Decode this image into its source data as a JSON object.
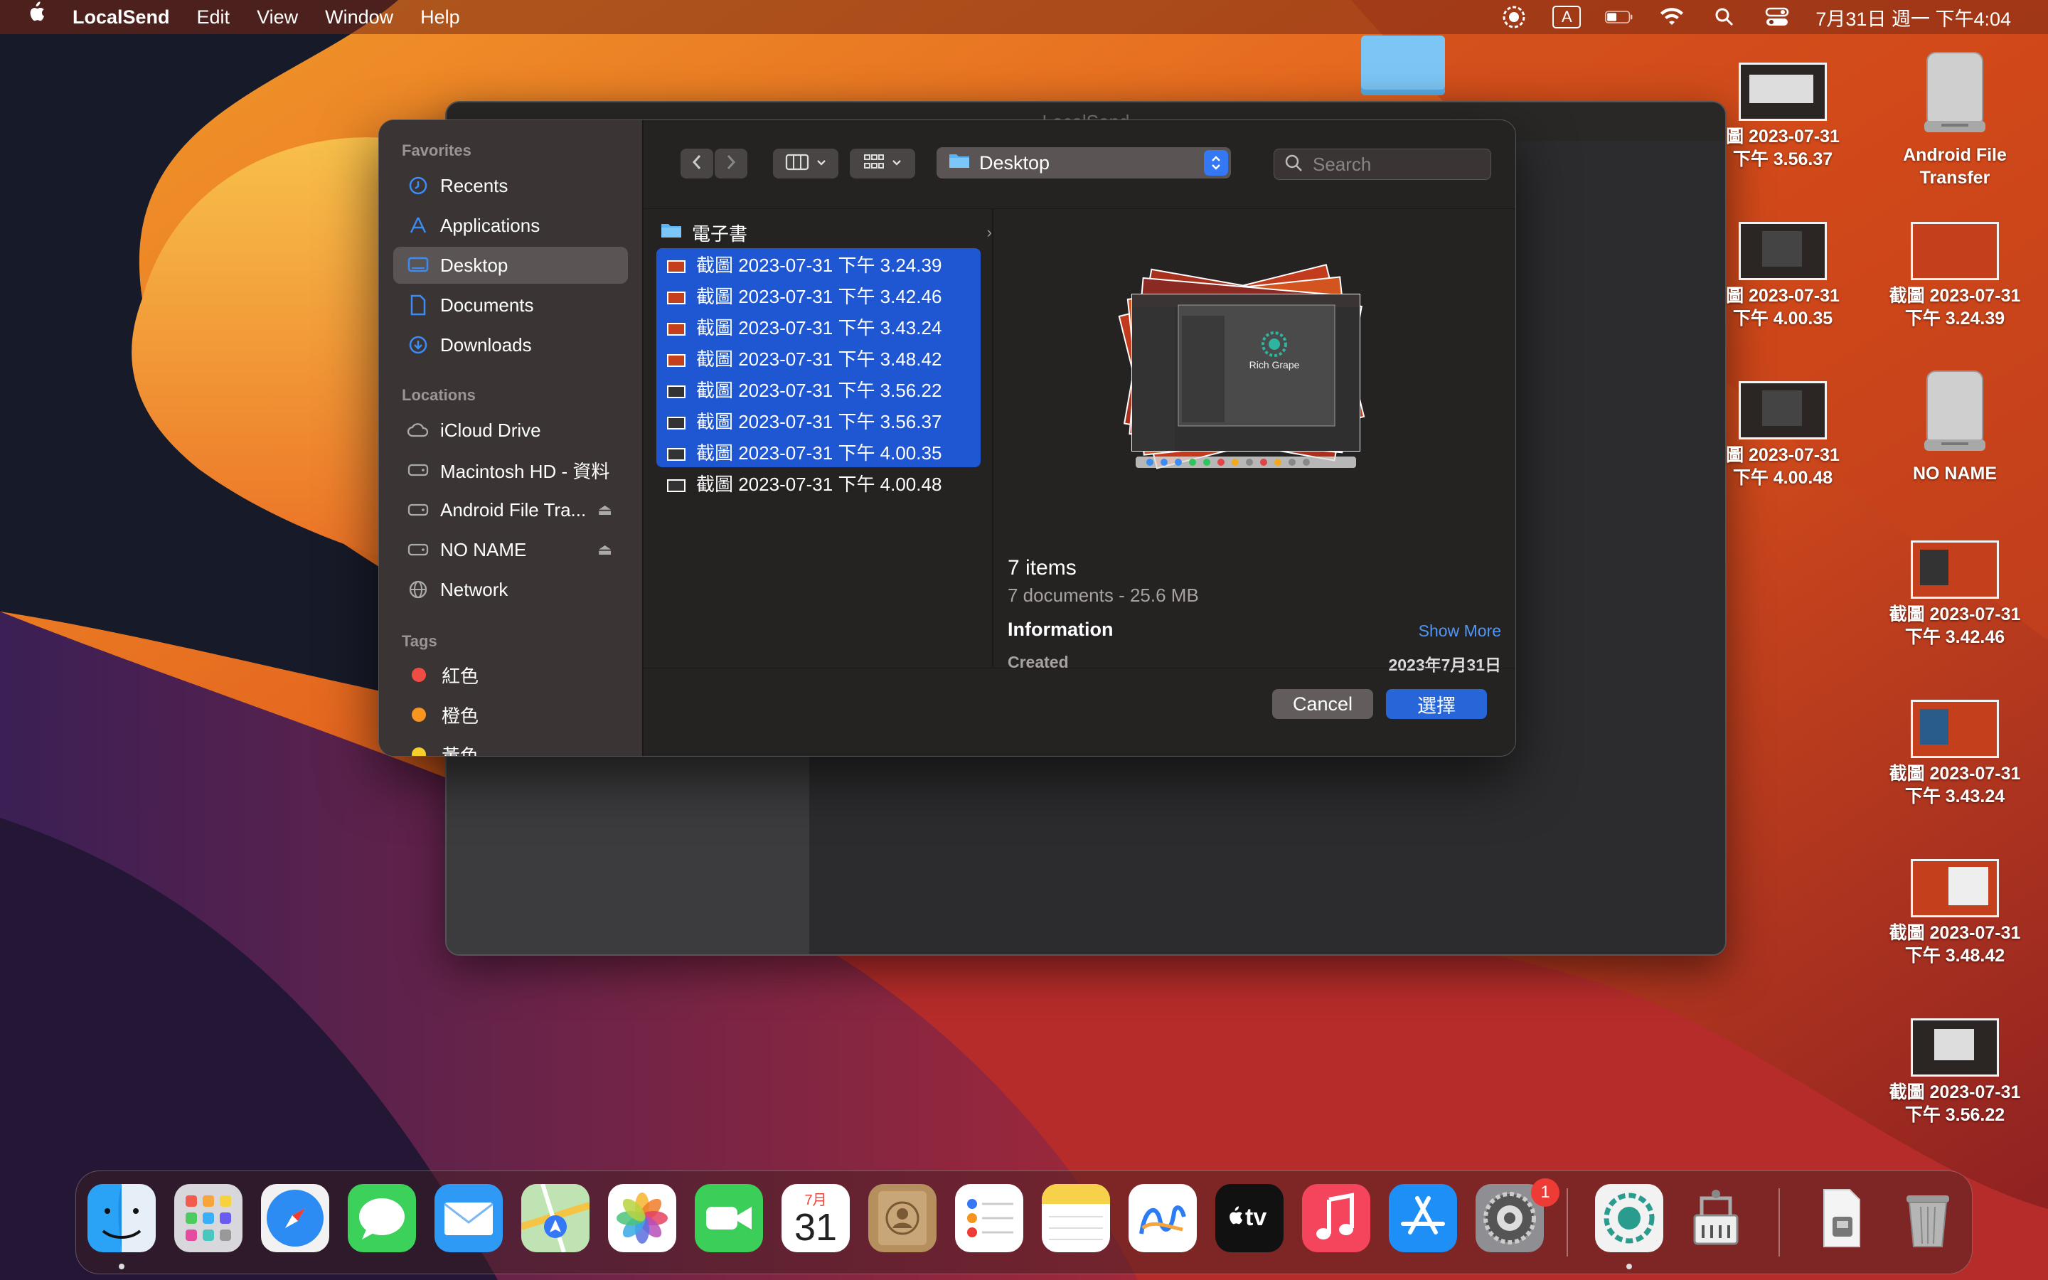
{
  "menubar": {
    "app_name": "LocalSend",
    "menus": [
      "Edit",
      "View",
      "Window",
      "Help"
    ],
    "input_source": "A",
    "datetime": "7月31日 週一 下午4:04"
  },
  "background_window": {
    "title": "LocalSend"
  },
  "dialog": {
    "sidebar": {
      "favorites_header": "Favorites",
      "favorites": [
        "Recents",
        "Applications",
        "Desktop",
        "Documents",
        "Downloads"
      ],
      "active_favorite": "Desktop",
      "locations_header": "Locations",
      "locations": [
        "iCloud Drive",
        "Macintosh HD - 資料",
        "Android File Tra...",
        "NO NAME",
        "Network"
      ],
      "tags_header": "Tags",
      "tags": [
        {
          "label": "紅色",
          "color": "#ef4c45"
        },
        {
          "label": "橙色",
          "color": "#f6951f"
        },
        {
          "label": "黃色",
          "color": "#f7cf2b"
        }
      ]
    },
    "toolbar": {
      "current_folder": "Desktop",
      "search_placeholder": "Search"
    },
    "files": {
      "folder": "電子書",
      "items": [
        {
          "name": "截圖 2023-07-31 下午 3.24.39",
          "selected": true
        },
        {
          "name": "截圖 2023-07-31 下午 3.42.46",
          "selected": true
        },
        {
          "name": "截圖 2023-07-31 下午 3.43.24",
          "selected": true
        },
        {
          "name": "截圖 2023-07-31 下午 3.48.42",
          "selected": true
        },
        {
          "name": "截圖 2023-07-31 下午 3.56.22",
          "selected": true
        },
        {
          "name": "截圖 2023-07-31 下午 3.56.37",
          "selected": true
        },
        {
          "name": "截圖 2023-07-31 下午 4.00.35",
          "selected": true
        },
        {
          "name": "截圖 2023-07-31 下午 4.00.48",
          "selected": false
        }
      ]
    },
    "preview": {
      "thumb_title": "Rich Grape",
      "item_count": "7 items",
      "summary": "7 documents - 25.6 MB",
      "info_header": "Information",
      "show_more": "Show More",
      "created_label": "Created",
      "created_value": "2023年7月31日"
    },
    "buttons": {
      "cancel": "Cancel",
      "choose": "選擇"
    },
    "accent": "#3478f6"
  },
  "desktop": {
    "col1": [
      {
        "line1": "圖 2023-07-31",
        "line2": "下午 3.56.37"
      },
      {
        "line1": "圖 2023-07-31",
        "line2": "下午 4.00.35"
      },
      {
        "line1": "圖 2023-07-31",
        "line2": "下午 4.00.48"
      }
    ],
    "col2": [
      {
        "line1": "Android File",
        "line2": "Transfer",
        "kind": "drive"
      },
      {
        "line1": "截圖 2023-07-31",
        "line2": "下午 3.24.39"
      },
      {
        "line1": "NO NAME",
        "line2": "",
        "kind": "drive"
      },
      {
        "line1": "截圖 2023-07-31",
        "line2": "下午 3.42.46"
      },
      {
        "line1": "截圖 2023-07-31",
        "line2": "下午 3.43.24"
      },
      {
        "line1": "截圖 2023-07-31",
        "line2": "下午 3.48.42"
      },
      {
        "line1": "截圖 2023-07-31",
        "line2": "下午 3.56.22"
      }
    ]
  },
  "dock": {
    "apps": [
      "Finder",
      "Launchpad",
      "Safari",
      "Messages",
      "Mail",
      "Maps",
      "Photos",
      "FaceTime",
      "Calendar",
      "Contacts",
      "Reminders",
      "Notes",
      "Freeform",
      "TV",
      "Music",
      "App Store",
      "System Settings",
      "LocalSend",
      "Archive Utility",
      "Downloads",
      "Trash"
    ],
    "calendar_month": "7月",
    "calendar_day": "31",
    "settings_badge": "1",
    "tv_label": "tv"
  }
}
